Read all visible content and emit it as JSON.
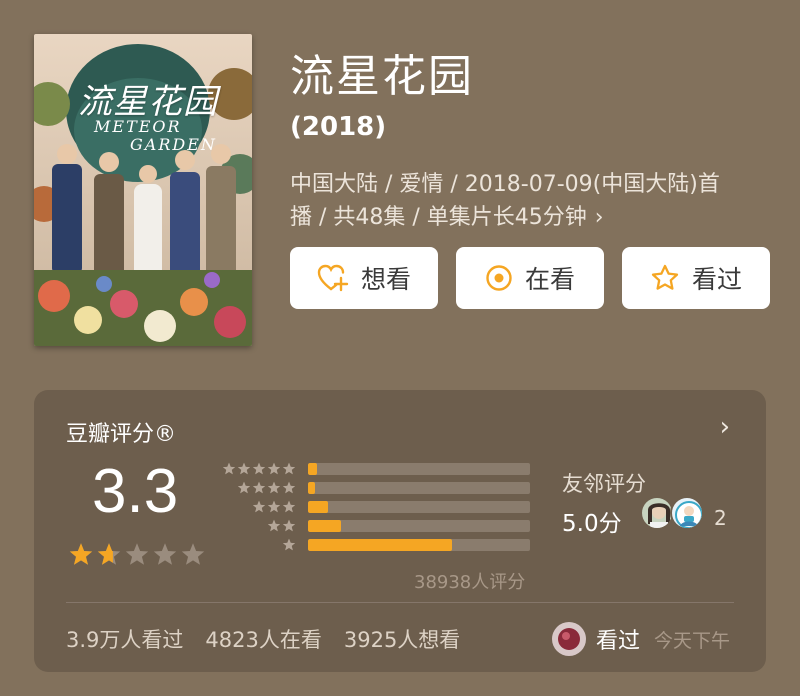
{
  "movie": {
    "title": "流星花园",
    "year": "(2018)",
    "meta_line1": "中国大陆 / 爱情 / 2018-07-09(中国大陆)首",
    "meta_line2": "播 / 共48集 / 单集片长45分钟",
    "meta_more": "›"
  },
  "poster": {
    "title": "流星花园",
    "subtitle_line1": "METEOR",
    "subtitle_line2": "GARDEN"
  },
  "actions": [
    {
      "label": "想看",
      "icon": "heart-plus-icon"
    },
    {
      "label": "在看",
      "icon": "target-circle-icon"
    },
    {
      "label": "看过",
      "icon": "star-outline-icon"
    }
  ],
  "rating": {
    "title": "豆瓣评分®",
    "arrow": "›",
    "score": "3.3",
    "star_level": 0.33,
    "distribution": [
      {
        "stars": 5,
        "percent": 4
      },
      {
        "stars": 4,
        "percent": 3
      },
      {
        "stars": 3,
        "percent": 9
      },
      {
        "stars": 2,
        "percent": 15
      },
      {
        "stars": 1,
        "percent": 65
      }
    ],
    "count_label": "38938人评分",
    "friends_label": "友邻评分",
    "friends_score": "5.0分",
    "friends_count": "2"
  },
  "stats": {
    "watched": "3.9万人看过",
    "watching": "4823人在看",
    "want": "3925人想看"
  },
  "user_status": {
    "label": "看过",
    "time": "今天下午"
  },
  "colors": {
    "background": "#82715c",
    "panel": "#6d5e4d",
    "accent": "#f5a623",
    "button_bg": "#ffffff"
  }
}
